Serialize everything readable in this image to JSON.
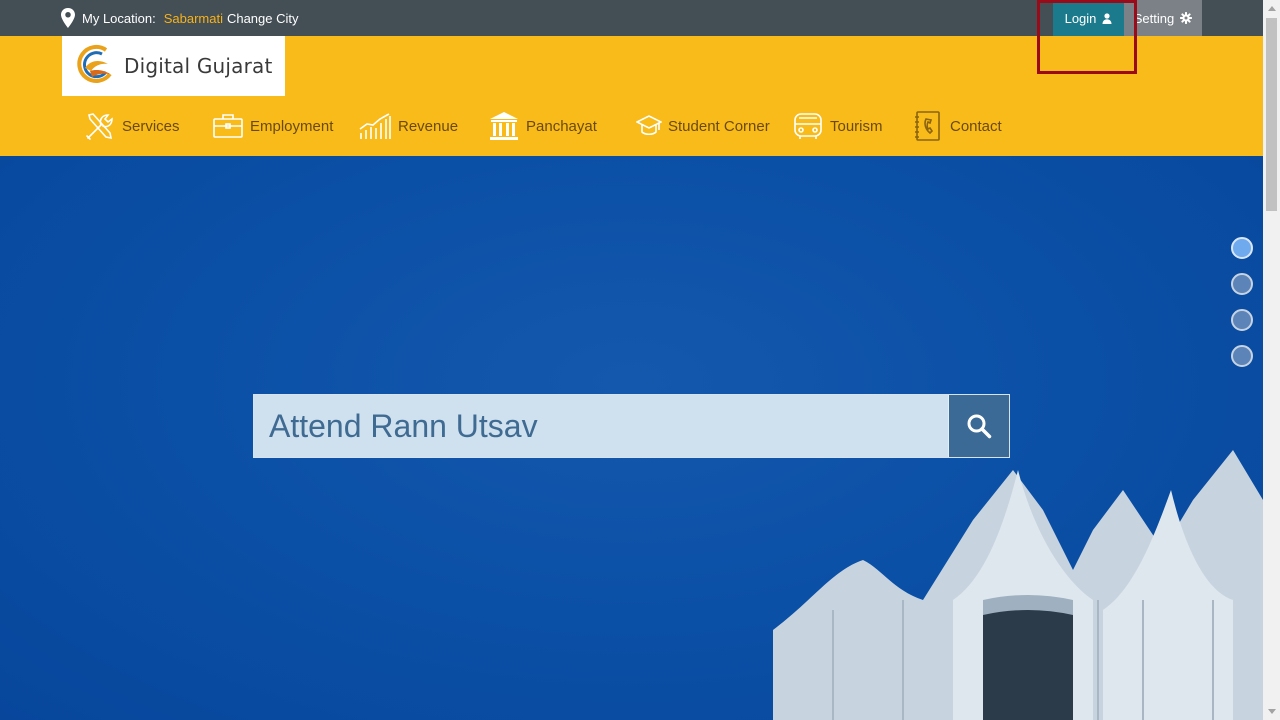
{
  "topbar": {
    "location_label": "My Location:",
    "city": "Sabarmati",
    "change_city": "Change City",
    "login_label": "Login",
    "setting_label": "Setting"
  },
  "logo": {
    "text": "Digital Gujarat"
  },
  "nav": {
    "items": [
      {
        "label": "Services",
        "icon": "tools-icon"
      },
      {
        "label": "Employment",
        "icon": "briefcase-icon"
      },
      {
        "label": "Revenue",
        "icon": "chart-icon"
      },
      {
        "label": "Panchayat",
        "icon": "building-icon"
      },
      {
        "label": "Student Corner",
        "icon": "graduation-cap-icon"
      },
      {
        "label": "Tourism",
        "icon": "bus-icon"
      },
      {
        "label": "Contact",
        "icon": "phone-book-icon"
      }
    ]
  },
  "hero": {
    "search_value": "Attend Rann Utsav",
    "slides": [
      {
        "active": true
      },
      {
        "active": false
      },
      {
        "active": false
      },
      {
        "active": false
      }
    ]
  },
  "colors": {
    "topbar": "#434e55",
    "header": "#f9bb1a",
    "login": "#1b7b8c",
    "setting": "#7b8186",
    "hero": "#0b52a8",
    "city": "#f7b21a",
    "highlight": "#9b0a18"
  }
}
